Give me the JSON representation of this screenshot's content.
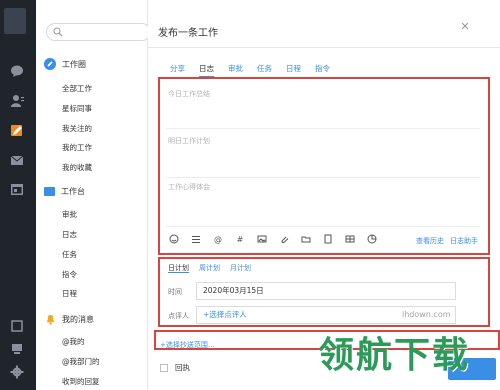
{
  "sidebar_nav": {
    "search_placeholder": "",
    "groups": [
      {
        "label": "工作圈",
        "items": [
          "全部工作",
          "星标同事",
          "我关注的",
          "我的工作",
          "我的收藏"
        ]
      },
      {
        "label": "工作台",
        "items": [
          "审批",
          "日志",
          "任务",
          "指令",
          "日程"
        ]
      },
      {
        "label": "我的消息",
        "items": [
          "@我的",
          "@我部门的",
          "收到的回复"
        ]
      }
    ]
  },
  "main": {
    "title": "发布一条工作",
    "tabs": [
      "分享",
      "日志",
      "审批",
      "任务",
      "日程",
      "指令"
    ],
    "active_tab": "日志",
    "placeholders": {
      "summary": "今日工作总结",
      "plan": "明日工作计划",
      "thoughts": "工作心得体会"
    },
    "toolbar_links": {
      "history": "查看历史",
      "assistant": "日志助手"
    },
    "plan_tabs": [
      "日计划",
      "周计划",
      "月计划"
    ],
    "active_plan_tab": "日计划",
    "fields": {
      "time_label": "时间",
      "time_value": "2020年03月15日",
      "reviewer_label": "点评人",
      "reviewer_value": "+选择点评人"
    },
    "cc_link": "+选择抄送范围...",
    "receipt_label": "回执"
  },
  "watermark": {
    "url": "lhdown.com",
    "text": "领航下载"
  },
  "colors": {
    "rail": "#20242b",
    "accent": "#3a8ee6",
    "highlight_box": "#d9453c",
    "watermark": "#2c9b5a"
  }
}
